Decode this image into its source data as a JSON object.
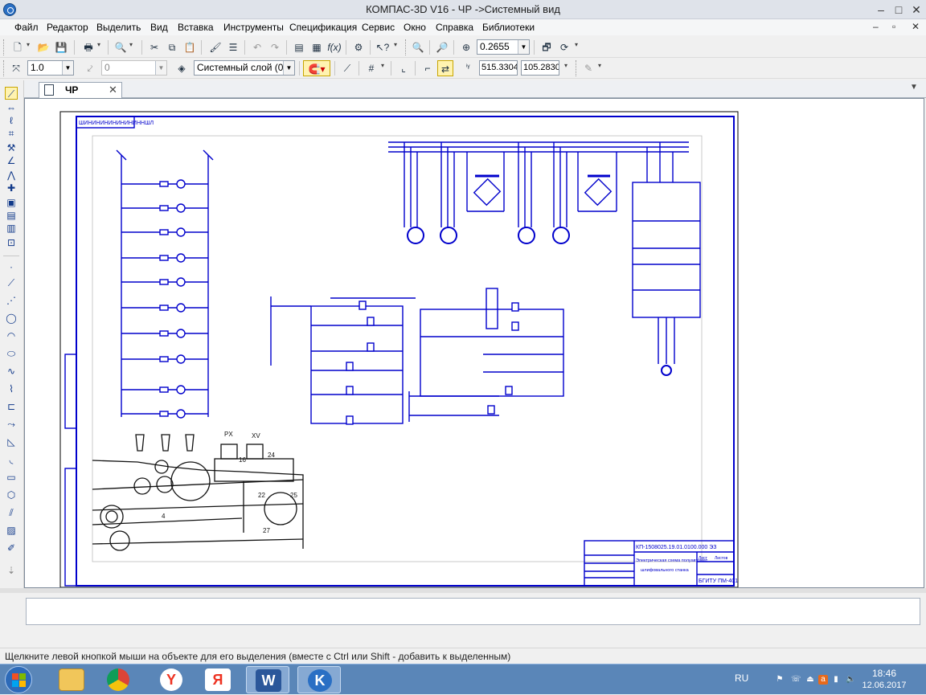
{
  "window": {
    "title": "КОМПАС-3D V16  - ЧР ->Системный вид",
    "minimize_icon": "minimize-icon",
    "maximize_icon": "maximize-icon",
    "close_icon": "close-icon"
  },
  "menu": {
    "items": [
      "Файл",
      "Редактор",
      "Выделить",
      "Вид",
      "Вставка",
      "Инструменты",
      "Спецификация",
      "Сервис",
      "Окно",
      "Справка",
      "Библиотеки"
    ]
  },
  "toolbar_standard": {
    "zoom_value": "0.2655"
  },
  "toolbar_format": {
    "line_width": "1.0",
    "step_value": "0",
    "layer": "Системный слой (0)",
    "coord_x": "515.3304",
    "coord_y": "105.2830"
  },
  "tabs": [
    {
      "label": "ЧР"
    }
  ],
  "drawing": {
    "legend_stamp": "ШИНИНИНИНИНИНИННШЛ",
    "title_block_code": "КП-1508025.19.01.0100.000 ЭЗ",
    "title_block_name_line1": "Электрическая схема полуавтомат",
    "title_block_name_line2": "шлифовального станка",
    "title_block_org": "БГИТУ ПМ-401",
    "title_block_sheet": "Лист",
    "title_block_sheets": "Листов",
    "mech_labels": [
      "PX",
      "XV",
      "16",
      "24",
      "22",
      "25",
      "27",
      "4"
    ]
  },
  "status": {
    "hint": "Щелкните левой кнопкой мыши на объекте для его выделения (вместе с Ctrl или Shift - добавить к выделенным)"
  },
  "taskbar": {
    "lang": "RU",
    "time": "18:46",
    "date": "12.06.2017",
    "apps": [
      {
        "icon": "file-explorer-icon",
        "glyph": ""
      },
      {
        "icon": "chrome-icon",
        "glyph": ""
      },
      {
        "icon": "yandex-browser-icon",
        "glyph": "Y"
      },
      {
        "icon": "yandex-icon",
        "glyph": "Я"
      },
      {
        "icon": "word-icon",
        "glyph": "W"
      },
      {
        "icon": "kompas-icon",
        "glyph": "K"
      }
    ]
  },
  "colors": {
    "schematic": "#0000cc",
    "accent": "#2a6fc4"
  }
}
